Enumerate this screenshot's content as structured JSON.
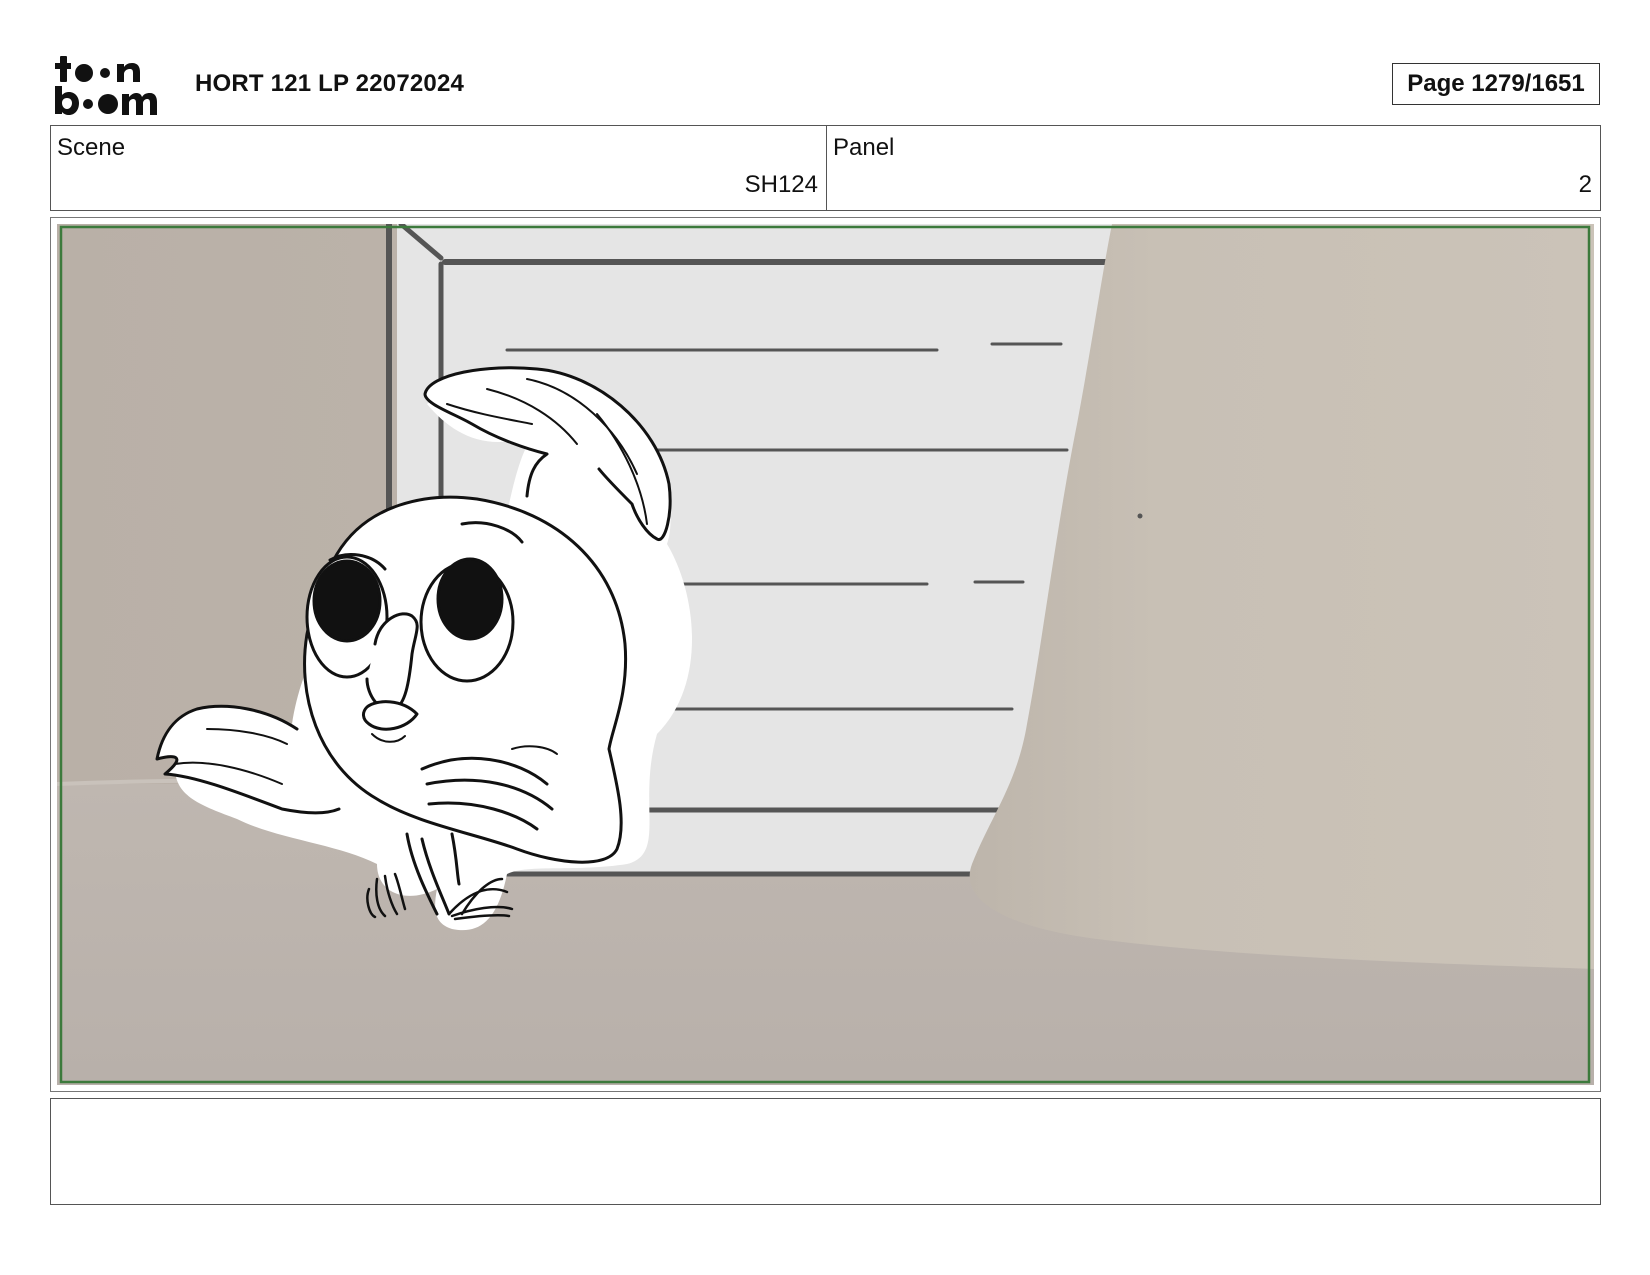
{
  "header": {
    "logo": {
      "line1": "toon",
      "line2": "boom",
      "icon": "toon-boom-logo"
    },
    "title": "HORT 121 LP 22072024",
    "page": "Page 1279/1651"
  },
  "info": {
    "scene_label": "Scene",
    "scene_value": "SH124",
    "panel_label": "Panel",
    "panel_value": "2"
  },
  "panel": {
    "description_icon": "storyboard-drawing",
    "safe_frame_color": "#3c7a3c"
  },
  "notes": {
    "text": ""
  }
}
